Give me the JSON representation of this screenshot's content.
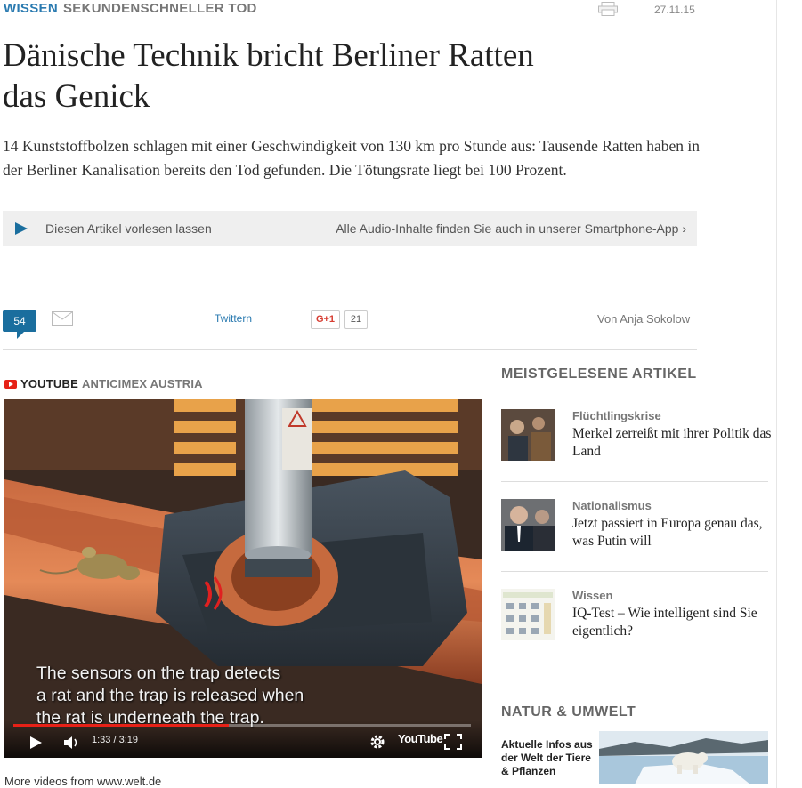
{
  "article": {
    "section": "WISSEN",
    "topic": "SEKUNDENSCHNELLER TOD",
    "date": "27.11.15",
    "headline": "Dänische Technik bricht Berliner Ratten das Genick",
    "lead": "14 Kunststoffbolzen schlagen mit einer Geschwindigkeit von 130 km pro Stunde aus: Tausende Ratten haben in der Berliner Kanalisation bereits den Tod gefunden. Die Tötungsrate liegt bei 100 Prozent.",
    "audio": {
      "label": "Diesen Artikel vorlesen lassen",
      "app_link": "Alle Audio-Inhalte finden Sie auch in unserer Smartphone-App ›"
    },
    "social": {
      "comments": "54",
      "twitter": "Twittern",
      "gplus": "G+1",
      "gplus_count": "21"
    },
    "author": "Von Anja Sokolow"
  },
  "video": {
    "source": "YOUTUBE",
    "channel": "ANTICIMEX AUSTRIA",
    "subtitle": "The sensors on the trap detects\na rat and the trap is released when\nthe rat is underneath the trap.",
    "time": "1:33 / 3:19",
    "progress": 0.47,
    "yt_logo": "YouTube",
    "more_link": "More videos from www.welt.de"
  },
  "sidebar": {
    "most_read_heading": "MEISTGELESENE ARTIKEL",
    "items": [
      {
        "category": "Flüchtlingskrise",
        "title": "Merkel zerreißt mit ihrer Politik das Land"
      },
      {
        "category": "Nationalismus",
        "title": "Jetzt passiert in Europa genau das, was Putin will"
      },
      {
        "category": "Wissen",
        "title": "IQ-Test – Wie intelligent sind Sie eigentlich?"
      }
    ],
    "natur_heading": "NATUR & UMWELT",
    "natur_teaser": "Aktuelle Infos aus der Welt der Tiere & Pflanzen"
  },
  "colors": {
    "accent": "#2a7ab0",
    "comment_bubble": "#1a6e9e",
    "youtube_red": "#e62117"
  }
}
